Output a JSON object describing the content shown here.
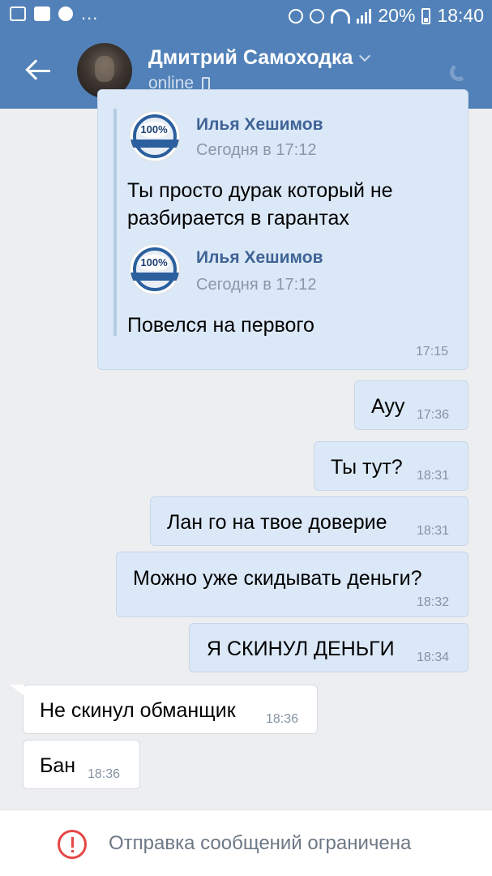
{
  "status_bar": {
    "battery": "20%",
    "time": "18:40",
    "more": "..."
  },
  "header": {
    "title": "Дмитрий Самоходка",
    "status": "online"
  },
  "forwarded": [
    {
      "name": "Илья Хешимов",
      "date": "Сегодня в 17:12",
      "text_line1": "Ты просто дурак который не",
      "text_line2": "разбирается в гарантах",
      "seal": "100%"
    },
    {
      "name": "Илья Хешимов",
      "date": "Сегодня в 17:12",
      "text_line1": "Повелся на первого",
      "seal": "100%"
    }
  ],
  "forwarded_time": "17:15",
  "messages": [
    {
      "direction": "out",
      "text": "Ауу",
      "time": "17:36"
    },
    {
      "direction": "out",
      "text": "Ты тут?",
      "time": "18:31"
    },
    {
      "direction": "out",
      "text": "Лан го на твое доверие",
      "time": "18:31"
    },
    {
      "direction": "out",
      "text": "Можно уже скидывать деньги?",
      "time": "18:32"
    },
    {
      "direction": "out",
      "text": "Я СКИНУЛ ДЕНЬГИ",
      "time": "18:34"
    },
    {
      "direction": "in",
      "text": "Не скинул обманщик",
      "time": "18:36"
    },
    {
      "direction": "in",
      "text": "Бан",
      "time": "18:36"
    }
  ],
  "footer": {
    "notice": "Отправка сообщений ограничена"
  },
  "colors": {
    "header": "#5181b8",
    "outgoing_bubble": "#dbe8f7",
    "incoming_bubble": "#ffffff",
    "chat_background": "#edeef0",
    "warning": "#e64646"
  }
}
